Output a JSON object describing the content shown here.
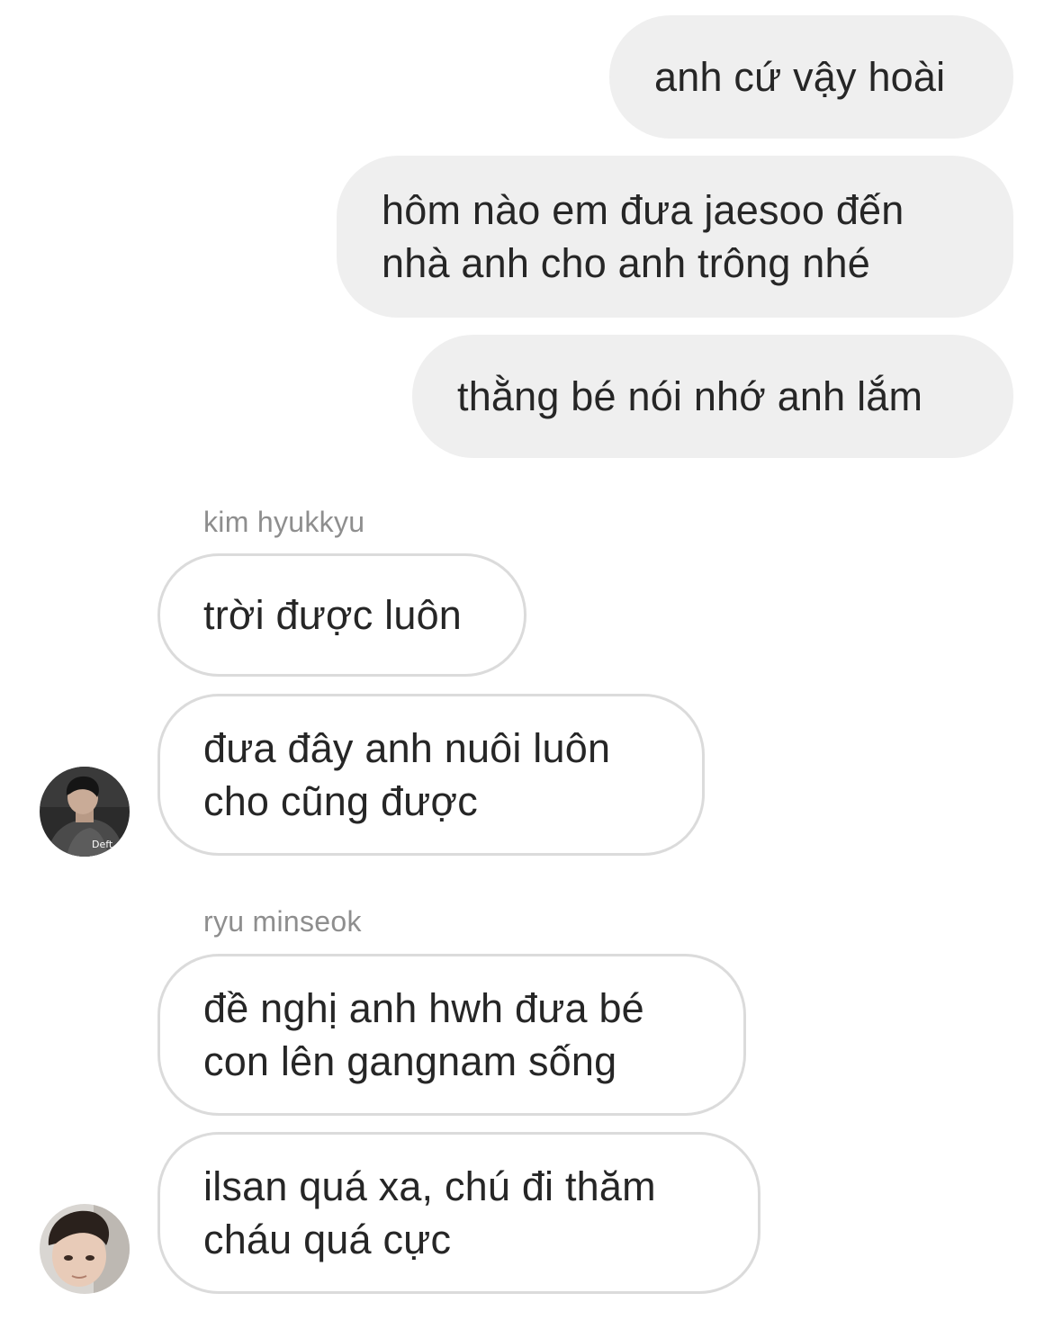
{
  "thread": {
    "outgoing": [
      {
        "text": "anh cứ vậy hoài"
      },
      {
        "text": "hôm nào em đưa jaesoo đến\nnhà anh cho anh trông nhé"
      },
      {
        "text": "thằng bé nói nhớ anh lắm"
      }
    ],
    "groups": [
      {
        "sender": "kim hyukkyu",
        "avatar_badge": "Deft",
        "messages": [
          {
            "text": "trời được luôn"
          },
          {
            "text": "đưa đây anh nuôi luôn\ncho cũng được"
          }
        ]
      },
      {
        "sender": "ryu minseok",
        "messages": [
          {
            "text": "đề nghị anh hwh đưa bé\ncon lên gangnam sống"
          },
          {
            "text": "ilsan quá xa, chú đi thăm\ncháu quá cực"
          }
        ]
      }
    ]
  },
  "colors": {
    "outgoing_bubble": "#efefef",
    "incoming_border": "#dbdbdb",
    "text": "#262626",
    "sender_label": "#8e8e8e"
  },
  "icons": {
    "avatar_1": "user-avatar-photo",
    "avatar_2": "user-avatar-photo"
  }
}
